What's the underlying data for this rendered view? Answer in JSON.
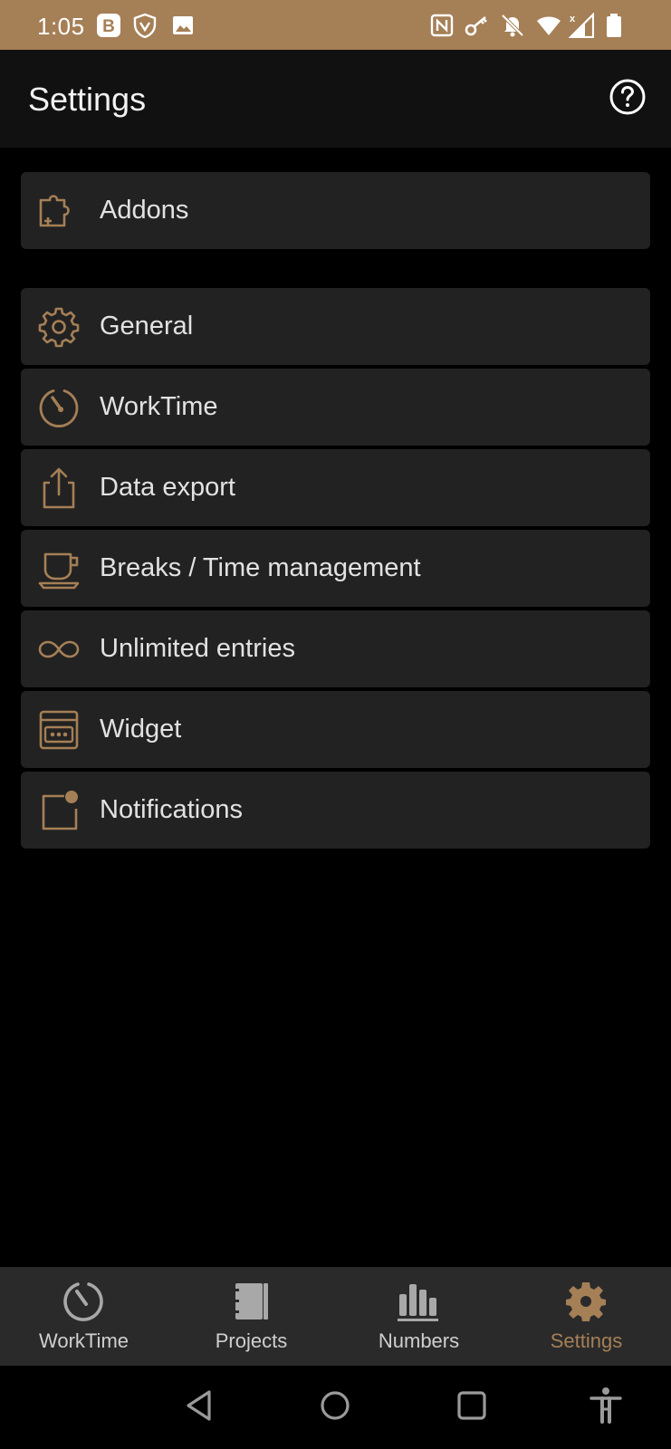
{
  "status_bar": {
    "time": "1:05",
    "background": "#a57f56",
    "icons": [
      "b-app-icon",
      "vpn-shield-icon",
      "image-icon",
      "nfc-icon",
      "key-icon",
      "bell-off-icon",
      "wifi-icon",
      "signal-icon",
      "battery-icon"
    ]
  },
  "header": {
    "title": "Settings",
    "help_icon": "help-circle-icon"
  },
  "settings": {
    "items": [
      {
        "label": "Addons",
        "icon": "puzzle-icon"
      },
      {
        "label": "General",
        "icon": "gear-icon"
      },
      {
        "label": "WorkTime",
        "icon": "timer-icon"
      },
      {
        "label": "Data export",
        "icon": "export-icon"
      },
      {
        "label": "Breaks / Time management",
        "icon": "coffee-cup-icon"
      },
      {
        "label": "Unlimited entries",
        "icon": "infinity-icon"
      },
      {
        "label": "Widget",
        "icon": "widget-icon"
      },
      {
        "label": "Notifications",
        "icon": "notification-icon"
      }
    ]
  },
  "bottom_nav": {
    "items": [
      {
        "label": "WorkTime",
        "icon": "timer-icon",
        "active": false
      },
      {
        "label": "Projects",
        "icon": "notebook-icon",
        "active": false
      },
      {
        "label": "Numbers",
        "icon": "bar-chart-icon",
        "active": false
      },
      {
        "label": "Settings",
        "icon": "gear-icon",
        "active": true
      }
    ]
  },
  "system_nav": {
    "icons": [
      "back-icon",
      "home-icon",
      "recents-icon",
      "accessibility-icon"
    ]
  },
  "colors": {
    "accent": "#a57f56",
    "item_background": "#222222",
    "header_background": "#111111",
    "nav_background": "#2a2a2a"
  }
}
